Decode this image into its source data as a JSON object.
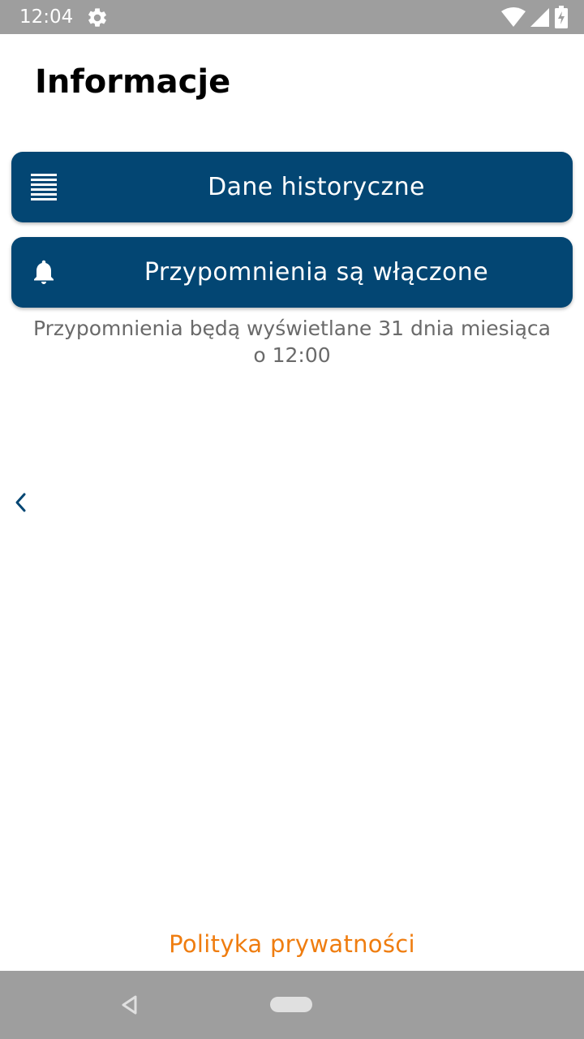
{
  "status_bar": {
    "time": "12:04",
    "icons": [
      "settings-gear-icon",
      "wifi-icon",
      "cell-signal-icon",
      "battery-icon"
    ]
  },
  "page": {
    "title": "Informacje"
  },
  "buttons": {
    "history": {
      "label": "Dane historyczne",
      "icon": "list-icon"
    },
    "reminders": {
      "label": "Przypomnienia są włączone",
      "icon": "bell-icon"
    }
  },
  "reminder_info": {
    "line1": "Przypomnienia będą wyświetlane 31 dnia miesiąca",
    "line2": "o 12:00"
  },
  "navigation": {
    "back_icon": "chevron-left-icon"
  },
  "footer": {
    "privacy_link": "Polityka prywatności"
  },
  "colors": {
    "primary": "#034673",
    "accent": "#ef7d10",
    "muted_text": "#6a6a6a",
    "system_bar": "#9e9e9e"
  }
}
